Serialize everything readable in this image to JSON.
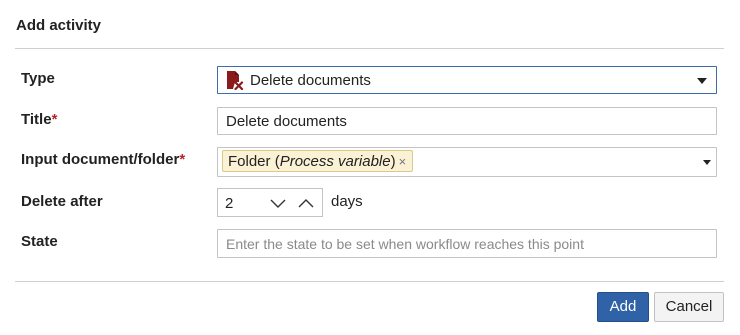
{
  "dialog": {
    "title": "Add activity"
  },
  "form": {
    "type": {
      "label": "Type",
      "value": "Delete documents",
      "icon": "delete-document-icon"
    },
    "title": {
      "label": "Title",
      "required_mark": "*",
      "value": "Delete documents"
    },
    "input_document": {
      "label": "Input document/folder",
      "required_mark": "*",
      "tag": {
        "name": "Folder",
        "open_paren": "(",
        "qualifier": "Process variable",
        "close_paren": ")",
        "remove": "×"
      }
    },
    "delete_after": {
      "label": "Delete after",
      "value": "2",
      "unit": "days"
    },
    "state": {
      "label": "State",
      "placeholder": "Enter the state to be set when workflow reaches this point"
    }
  },
  "buttons": {
    "add": "Add",
    "cancel": "Cancel"
  },
  "colors": {
    "primary": "#2f62a6",
    "required": "#b3262b",
    "tag_bg": "#fbf2d5",
    "icon_red": "#8b1a1a"
  }
}
